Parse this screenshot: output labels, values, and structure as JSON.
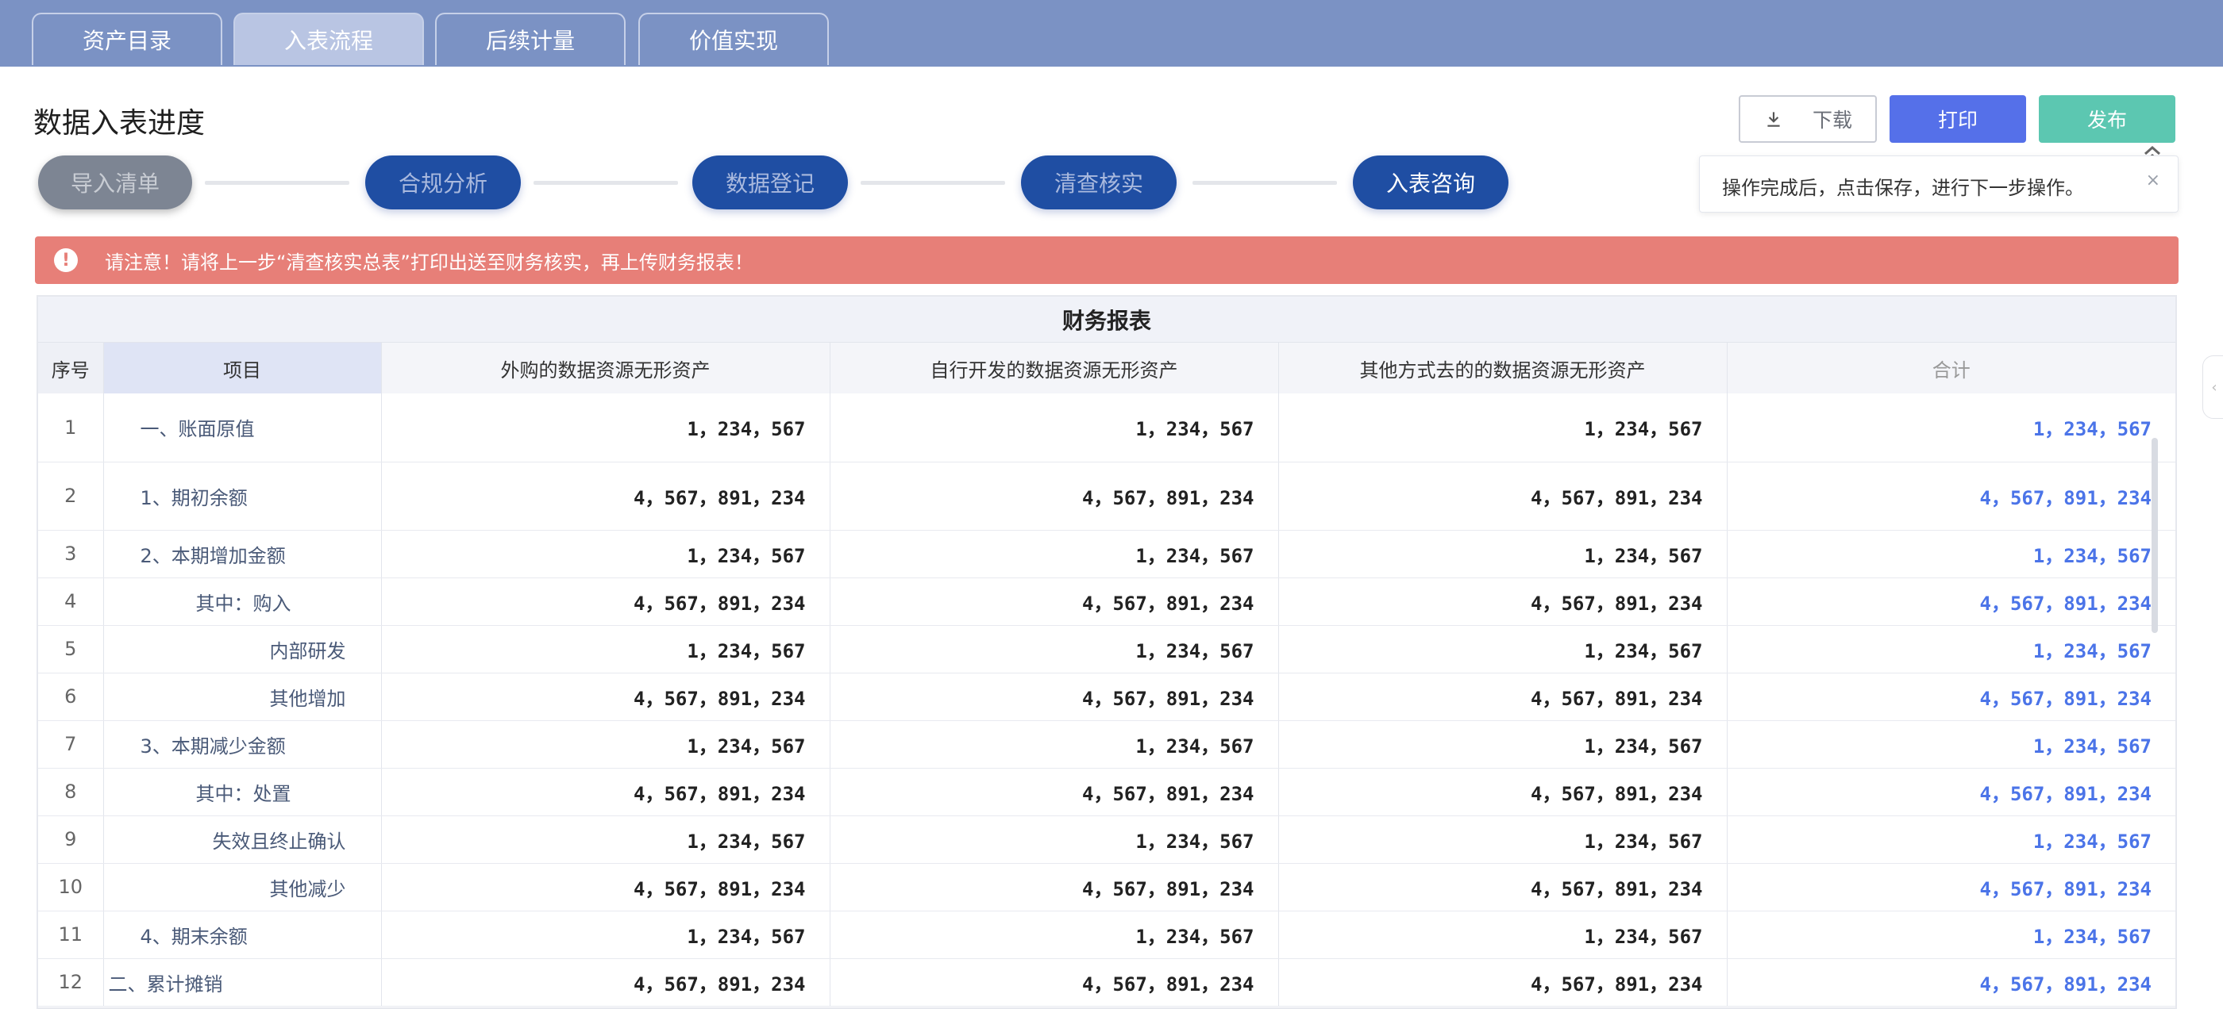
{
  "tabs": [
    "资产目录",
    "入表流程",
    "后续计量",
    "价值实现"
  ],
  "page_title": "数据入表进度",
  "buttons": {
    "download": "下载",
    "print": "打印",
    "publish": "发布"
  },
  "tooltip": {
    "text": "操作完成后，点击保存，进行下一步操作。",
    "close": "×"
  },
  "steps": [
    "导入清单",
    "合规分析",
    "数据登记",
    "清查核实",
    "入表咨询"
  ],
  "alert": {
    "icon": "!",
    "text": "请注意！请将上一步“清查核实总表”打印出送至财务核实，再上传财务报表！"
  },
  "table": {
    "title": "财务报表",
    "headers": [
      "序号",
      "项目",
      "外购的数据资源无形资产",
      "自行开发的数据资源无形资产",
      "其他方式去的的数据资源无形资产",
      "合计"
    ],
    "rows": [
      {
        "seq": "1",
        "item": "一、账面原值",
        "v1": "1，234，567",
        "v2": "1，234，567",
        "v3": "1，234，567",
        "total": "1，234，567"
      },
      {
        "seq": "2",
        "item": "1、期初余额",
        "v1": "4，567，891，234",
        "v2": "4，567，891，234",
        "v3": "4，567，891，234",
        "total": "4，567，891，234"
      },
      {
        "seq": "3",
        "item": "2、本期增加金额",
        "v1": "1，234，567",
        "v2": "1，234，567",
        "v3": "1，234，567",
        "total": "1，234，567"
      },
      {
        "seq": "4",
        "item": "其中：购入",
        "v1": "4，567，891，234",
        "v2": "4，567，891，234",
        "v3": "4，567，891，234",
        "total": "4，567，891，234"
      },
      {
        "seq": "5",
        "item": "内部研发",
        "v1": "1，234，567",
        "v2": "1，234，567",
        "v3": "1，234，567",
        "total": "1，234，567"
      },
      {
        "seq": "6",
        "item": "其他增加",
        "v1": "4，567，891，234",
        "v2": "4，567，891，234",
        "v3": "4，567，891，234",
        "total": "4，567，891，234"
      },
      {
        "seq": "7",
        "item": "3、本期减少金额",
        "v1": "1，234，567",
        "v2": "1，234，567",
        "v3": "1，234，567",
        "total": "1，234，567"
      },
      {
        "seq": "8",
        "item": "其中：处置",
        "v1": "4，567，891，234",
        "v2": "4，567，891，234",
        "v3": "4，567，891，234",
        "total": "4，567，891，234"
      },
      {
        "seq": "9",
        "item": "失效且终止确认",
        "v1": "1，234，567",
        "v2": "1，234，567",
        "v3": "1，234，567",
        "total": "1，234，567"
      },
      {
        "seq": "10",
        "item": "其他减少",
        "v1": "4，567，891，234",
        "v2": "4，567，891，234",
        "v3": "4，567，891，234",
        "total": "4，567，891，234"
      },
      {
        "seq": "11",
        "item": "4、期末余额",
        "v1": "1，234，567",
        "v2": "1，234，567",
        "v3": "1，234，567",
        "total": "1，234，567"
      },
      {
        "seq": "12",
        "item": "二、累计摊销",
        "v1": "4，567，891，234",
        "v2": "4，567，891，234",
        "v3": "4，567，891，234",
        "total": "4，567，891，234"
      }
    ]
  },
  "colors": {
    "topbar": "#7b92c4",
    "step_blue": "#1f4ea3",
    "print": "#5570e9",
    "publish": "#5cc7b1",
    "alert": "#e77f78",
    "total_text": "#4b74e8"
  }
}
